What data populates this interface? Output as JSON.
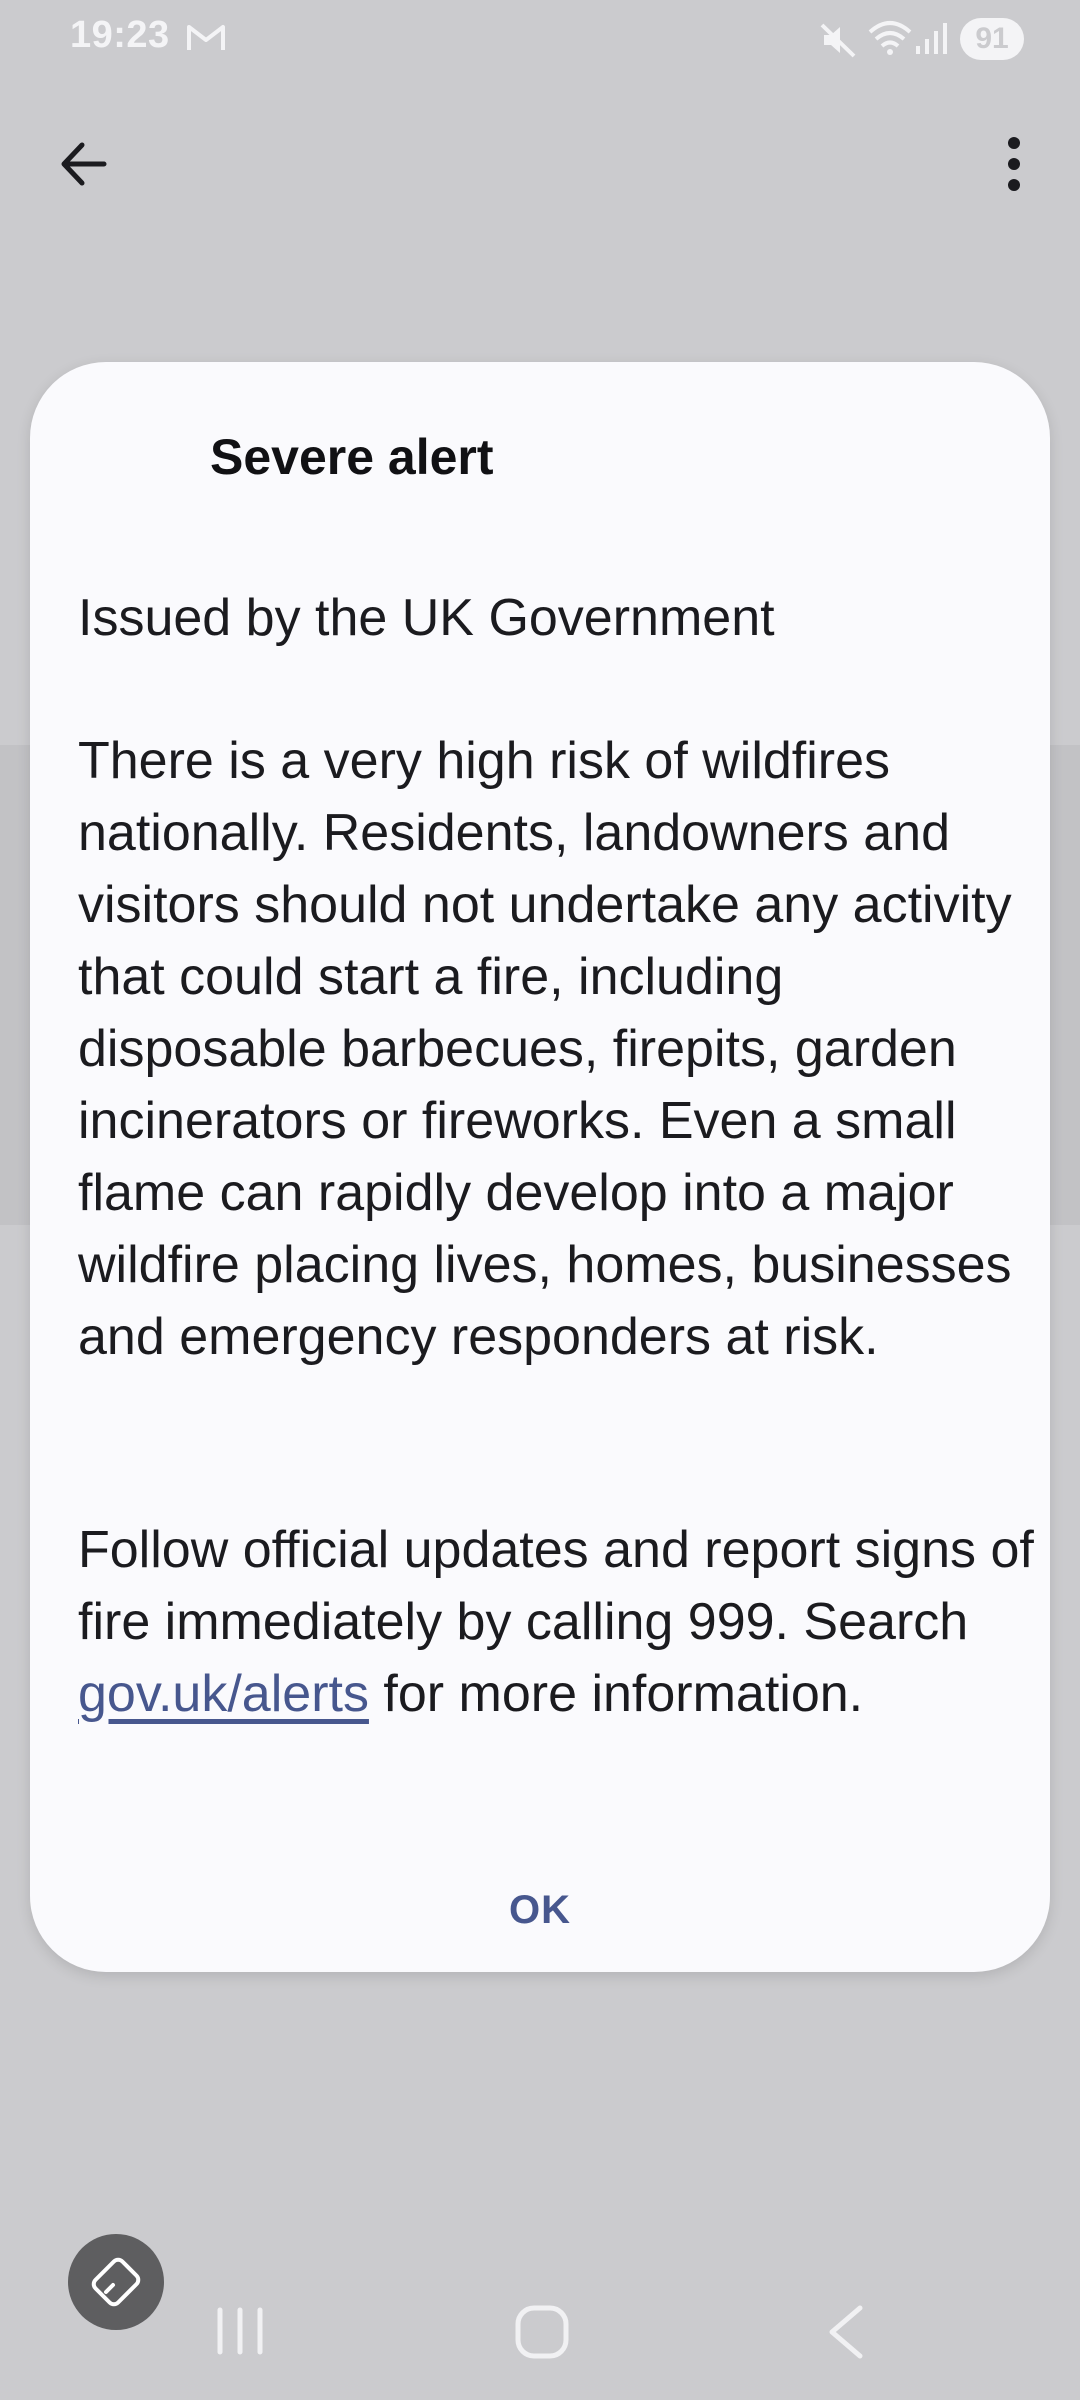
{
  "status_bar": {
    "time": "19:23",
    "battery": "91",
    "icons": [
      "gmail-icon",
      "mute-icon",
      "wifi-icon",
      "signal-icon"
    ]
  },
  "toolbar": {
    "back_icon": "arrow-left-icon",
    "menu_icon": "more-vertical-icon"
  },
  "dialog": {
    "title": "Severe alert",
    "issuer": "Issued by the UK Government",
    "body": "There is a very high risk of wildfires nationally. Residents, landowners and visitors should not undertake any activity that could start a fire, including disposable barbecues, firepits, garden incinerators or fireworks. Even a small flame can rapidly develop into a major wildfire placing lives, homes, businesses and emergency responders at risk.",
    "followup_before": "Follow official updates and report signs of fire immediately by calling 999. Search ",
    "link_text": "gov.uk/alerts",
    "followup_after": " for more information.",
    "ok_label": "OK"
  },
  "nav_bar": {
    "icons": [
      "rotate-screen-icon",
      "recents-icon",
      "home-icon",
      "back-icon"
    ]
  },
  "colors": {
    "background": "#cbcbce",
    "dialog": "#fafafd",
    "accent": "#47578e"
  }
}
